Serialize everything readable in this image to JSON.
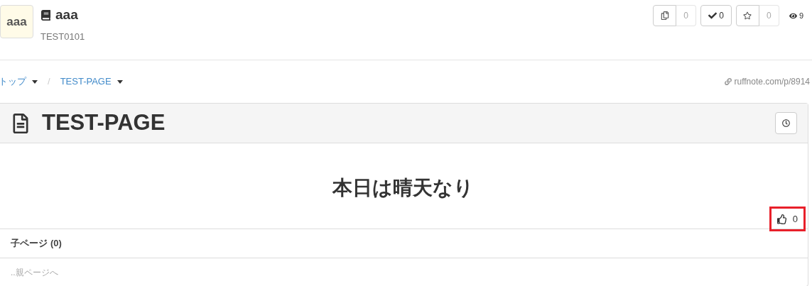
{
  "notebook": {
    "avatar_text": "aaa",
    "title": "aaa",
    "subtitle": "TEST0101"
  },
  "actions": [
    {
      "kind": "copy",
      "count": "0"
    },
    {
      "kind": "check",
      "count": "0"
    },
    {
      "kind": "star",
      "count": "0"
    }
  ],
  "views": "9",
  "breadcrumb_separator": "/",
  "breadcrumb": [
    {
      "label": "トップ"
    },
    {
      "label": "TEST-PAGE"
    }
  ],
  "permalink": "ruffnote.com/p/8914",
  "page": {
    "title": "TEST-PAGE",
    "content_heading": "本日は晴天なり",
    "likes": "0",
    "like_highlighted": true
  },
  "children": {
    "label": "子ページ",
    "count": "(0)"
  },
  "parent_link": "..親ページへ"
}
